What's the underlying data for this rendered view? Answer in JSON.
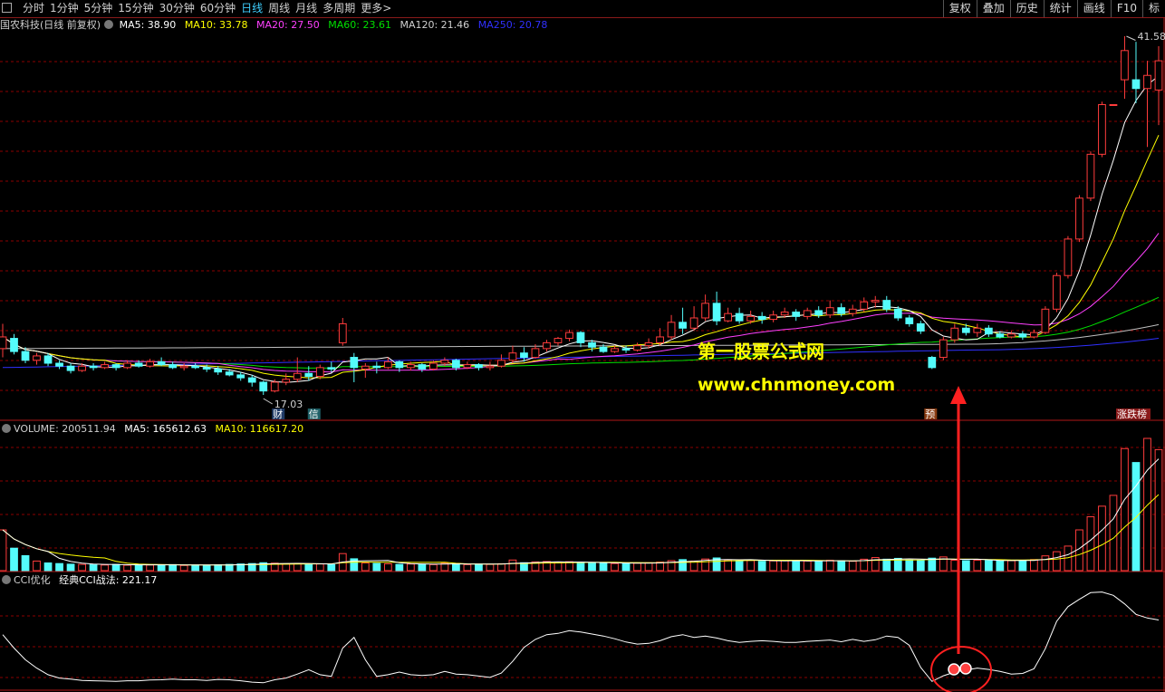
{
  "toolbar": {
    "periods": [
      "分时",
      "1分钟",
      "5分钟",
      "15分钟",
      "30分钟",
      "60分钟",
      "日线",
      "周线",
      "月线",
      "多周期",
      "更多>"
    ],
    "active_period": "日线",
    "right_buttons": [
      "复权",
      "叠加",
      "历史",
      "统计",
      "画线",
      "F10",
      "标"
    ]
  },
  "legend_price": {
    "title": "国农科技(日线 前复权)",
    "ma5": "MA5: 38.90",
    "ma10": "MA10: 33.78",
    "ma20": "MA20: 27.50",
    "ma60": "MA60: 23.61",
    "ma120": "MA120: 21.46",
    "ma250": "MA250: 20.78"
  },
  "legend_volume": {
    "title": "VOLUME: 200511.94",
    "ma5": "MA5: 165612.63",
    "ma10": "MA10: 116617.20"
  },
  "legend_cci": {
    "title": "CCI优化",
    "value": "经典CCI战法: 221.17"
  },
  "annotations": {
    "high_label": "41.58",
    "low_label": "17.03",
    "watermark_cn": "第一股票公式网",
    "watermark_url": "www.chnmoney.com",
    "markers": [
      "财",
      "信",
      "预",
      "涨跌榜"
    ]
  },
  "colors": {
    "up": "#ff3c3c",
    "down": "#54fcfc",
    "ma5": "#ffffff",
    "ma10": "#ffff00",
    "ma20": "#ff40ff",
    "ma60": "#00e000",
    "ma120": "#c0c0c0",
    "ma250": "#3030ff",
    "grid": "#8b0000"
  },
  "chart_data": {
    "type": "candlestick",
    "price_range": [
      17.03,
      41.58
    ],
    "candles": [
      [
        20.2,
        21.0,
        19.6,
        21.9
      ],
      [
        20.9,
        20.0,
        19.8,
        21.2
      ],
      [
        20.0,
        19.4,
        19.2,
        20.3
      ],
      [
        19.4,
        19.7,
        19.1,
        19.9
      ],
      [
        19.7,
        19.2,
        19.0,
        19.9
      ],
      [
        19.2,
        19.0,
        18.8,
        19.4
      ],
      [
        19.0,
        18.7,
        18.5,
        19.2
      ],
      [
        18.7,
        19.0,
        18.6,
        19.2
      ],
      [
        19.0,
        18.9,
        18.7,
        19.2
      ],
      [
        18.9,
        19.1,
        18.8,
        19.3
      ],
      [
        19.1,
        18.9,
        18.7,
        19.2
      ],
      [
        18.9,
        19.2,
        18.8,
        19.4
      ],
      [
        19.2,
        19.0,
        18.9,
        19.4
      ],
      [
        19.0,
        19.3,
        18.9,
        19.5
      ],
      [
        19.3,
        19.1,
        19.0,
        19.6
      ],
      [
        19.1,
        18.9,
        18.8,
        19.3
      ],
      [
        18.9,
        19.0,
        18.7,
        19.2
      ],
      [
        19.0,
        18.9,
        18.8,
        19.2
      ],
      [
        18.9,
        18.8,
        18.6,
        19.1
      ],
      [
        18.8,
        18.6,
        18.4,
        19.0
      ],
      [
        18.6,
        18.4,
        18.3,
        18.8
      ],
      [
        18.4,
        18.2,
        18.0,
        18.6
      ],
      [
        18.2,
        17.9,
        17.6,
        18.4
      ],
      [
        17.9,
        17.3,
        17.03,
        18.0
      ],
      [
        17.3,
        17.9,
        17.2,
        18.1
      ],
      [
        17.9,
        18.1,
        17.7,
        18.5
      ],
      [
        18.1,
        18.5,
        17.9,
        19.6
      ],
      [
        18.5,
        18.3,
        18.0,
        19.0
      ],
      [
        18.3,
        18.9,
        18.1,
        19.1
      ],
      [
        18.9,
        18.8,
        18.6,
        19.3
      ],
      [
        20.6,
        21.9,
        20.4,
        22.3
      ],
      [
        19.6,
        18.9,
        17.9,
        19.9
      ],
      [
        18.8,
        19.0,
        18.2,
        19.2
      ],
      [
        19.0,
        18.9,
        18.5,
        19.3
      ],
      [
        18.9,
        19.3,
        18.8,
        19.6
      ],
      [
        19.3,
        18.9,
        18.6,
        19.4
      ],
      [
        18.9,
        19.1,
        18.7,
        19.3
      ],
      [
        19.1,
        18.8,
        18.6,
        19.2
      ],
      [
        18.8,
        19.2,
        18.7,
        19.4
      ],
      [
        19.2,
        19.4,
        19.0,
        19.6
      ],
      [
        19.4,
        18.9,
        18.7,
        19.5
      ],
      [
        18.9,
        19.1,
        18.8,
        19.3
      ],
      [
        19.1,
        18.9,
        18.7,
        19.2
      ],
      [
        18.9,
        19.0,
        18.7,
        19.3
      ],
      [
        19.0,
        19.4,
        18.9,
        19.8
      ],
      [
        19.4,
        19.9,
        19.2,
        20.4
      ],
      [
        19.9,
        19.6,
        19.3,
        20.3
      ],
      [
        19.6,
        20.2,
        19.5,
        20.5
      ],
      [
        20.2,
        20.6,
        20.0,
        20.8
      ],
      [
        20.6,
        20.9,
        20.4,
        21.0
      ],
      [
        20.9,
        21.3,
        20.7,
        21.5
      ],
      [
        21.3,
        20.6,
        20.3,
        21.4
      ],
      [
        20.6,
        20.3,
        20.0,
        20.8
      ],
      [
        20.3,
        20.0,
        19.9,
        20.5
      ],
      [
        20.0,
        20.2,
        19.9,
        20.4
      ],
      [
        20.2,
        20.1,
        19.9,
        20.4
      ],
      [
        20.1,
        20.4,
        20.0,
        20.6
      ],
      [
        20.4,
        20.6,
        20.2,
        20.9
      ],
      [
        20.6,
        21.0,
        20.4,
        21.6
      ],
      [
        21.0,
        22.0,
        20.8,
        22.5
      ],
      [
        22.0,
        21.6,
        21.2,
        23.0
      ],
      [
        21.6,
        22.3,
        21.4,
        23.1
      ],
      [
        22.3,
        23.3,
        22.1,
        23.9
      ],
      [
        23.3,
        22.1,
        21.8,
        24.1
      ],
      [
        22.1,
        22.6,
        22.0,
        23.0
      ],
      [
        22.6,
        22.1,
        21.9,
        23.0
      ],
      [
        22.1,
        22.4,
        21.9,
        22.8
      ],
      [
        22.4,
        22.2,
        21.9,
        22.7
      ],
      [
        22.2,
        22.5,
        22.0,
        22.8
      ],
      [
        22.5,
        22.7,
        22.3,
        23.0
      ],
      [
        22.7,
        22.4,
        22.1,
        22.9
      ],
      [
        22.4,
        22.8,
        22.2,
        23.0
      ],
      [
        22.8,
        22.5,
        22.3,
        23.1
      ],
      [
        22.5,
        23.0,
        22.3,
        23.5
      ],
      [
        23.0,
        22.6,
        22.4,
        23.3
      ],
      [
        22.6,
        22.9,
        22.4,
        23.2
      ],
      [
        22.9,
        23.4,
        22.7,
        23.7
      ],
      [
        23.4,
        23.5,
        23.0,
        23.8
      ],
      [
        23.5,
        22.9,
        22.7,
        23.8
      ],
      [
        22.9,
        22.3,
        22.1,
        23.1
      ],
      [
        22.3,
        21.9,
        21.7,
        22.5
      ],
      [
        21.9,
        21.4,
        21.2,
        22.1
      ],
      [
        19.6,
        18.9,
        18.8,
        19.7
      ],
      [
        19.6,
        20.8,
        19.4,
        21.0
      ],
      [
        20.8,
        21.6,
        20.6,
        21.9
      ],
      [
        21.6,
        21.3,
        21.1,
        21.9
      ],
      [
        21.3,
        21.6,
        21.0,
        21.9
      ],
      [
        21.6,
        21.2,
        21.0,
        21.8
      ],
      [
        21.2,
        21.0,
        20.9,
        21.4
      ],
      [
        21.0,
        21.2,
        20.9,
        21.4
      ],
      [
        21.2,
        21.0,
        20.8,
        21.4
      ],
      [
        21.0,
        21.3,
        20.9,
        21.5
      ],
      [
        21.3,
        22.9,
        21.2,
        23.1
      ],
      [
        22.9,
        25.2,
        22.7,
        25.4
      ],
      [
        25.2,
        27.7,
        25.0,
        27.9
      ],
      [
        27.7,
        30.5,
        27.5,
        30.7
      ],
      [
        30.5,
        33.5,
        30.3,
        33.7
      ],
      [
        33.5,
        36.9,
        33.3,
        37.1
      ],
      [
        36.9,
        36.9,
        36.9,
        36.9
      ],
      [
        38.6,
        40.6,
        37.3,
        41.58
      ],
      [
        38.6,
        38.0,
        37.0,
        41.2
      ],
      [
        38.0,
        38.9,
        34.0,
        39.9
      ],
      [
        37.9,
        39.9,
        35.5,
        40.9
      ]
    ],
    "volume": [
      19.6,
      10.8,
      7.2,
      4.6,
      3.7,
      3.4,
      3.1,
      3.0,
      2.8,
      2.7,
      3.0,
      2.6,
      2.9,
      2.7,
      2.8,
      2.9,
      2.5,
      2.7,
      2.6,
      2.8,
      3.0,
      3.2,
      3.4,
      3.8,
      3.6,
      3.2,
      3.5,
      3.0,
      3.2,
      2.9,
      8.2,
      5.7,
      3.7,
      3.5,
      3.3,
      3.0,
      3.2,
      3.1,
      2.9,
      3.6,
      3.4,
      2.9,
      3.1,
      3.0,
      3.3,
      5.1,
      3.8,
      4.2,
      4.4,
      3.9,
      4.3,
      4.0,
      3.6,
      3.5,
      3.4,
      3.7,
      3.6,
      3.8,
      4.1,
      4.8,
      5.3,
      4.6,
      5.6,
      6.1,
      5.1,
      4.7,
      4.9,
      4.5,
      4.7,
      4.8,
      5.0,
      4.6,
      4.4,
      5.0,
      4.8,
      4.5,
      5.5,
      6.3,
      5.5,
      5.9,
      5.1,
      4.8,
      6.0,
      6.6,
      5.0,
      4.8,
      5.0,
      4.8,
      4.7,
      4.8,
      5.0,
      5.3,
      7.1,
      9.1,
      11.8,
      19.6,
      25.9,
      31.0,
      36.2,
      58.7,
      52.0,
      63.6,
      58.2
    ],
    "volume_unit": "index",
    "cci": [
      -20,
      -60,
      -95,
      -120,
      -140,
      -150,
      -153,
      -157,
      -158,
      -159,
      -160,
      -158,
      -158,
      -156,
      -155,
      -153,
      -155,
      -155,
      -157,
      -154,
      -155,
      -158,
      -162,
      -164,
      -155,
      -150,
      -138,
      -125,
      -140,
      -145,
      -60,
      -28,
      -95,
      -145,
      -140,
      -132,
      -140,
      -142,
      -140,
      -130,
      -138,
      -140,
      -144,
      -148,
      -135,
      -100,
      -58,
      -34,
      -20,
      -16,
      -8,
      -12,
      -18,
      -24,
      -32,
      -42,
      -48,
      -46,
      -38,
      -26,
      -20,
      -28,
      -24,
      -30,
      -38,
      -43,
      -40,
      -38,
      -40,
      -43,
      -43,
      -40,
      -38,
      -36,
      -41,
      -34,
      -40,
      -35,
      -24,
      -28,
      -52,
      -118,
      -160,
      -143,
      -132,
      -126,
      -120,
      -124,
      -130,
      -138,
      -136,
      -122,
      -62,
      20,
      64,
      86,
      106,
      108,
      98,
      72,
      41,
      30,
      24
    ],
    "cci_range": [
      -170,
      115
    ]
  }
}
